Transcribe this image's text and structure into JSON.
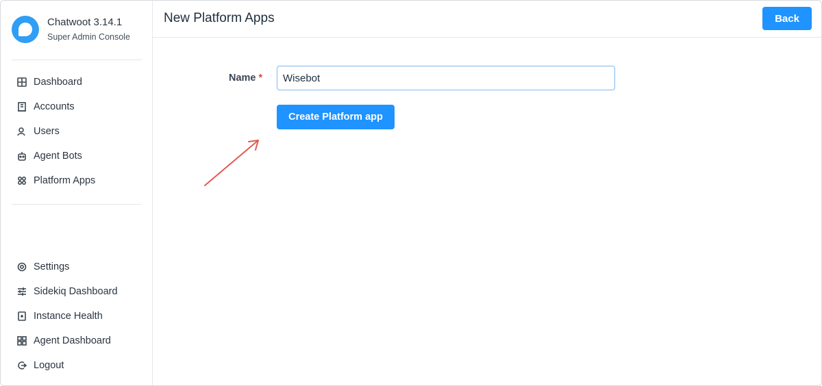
{
  "brand": {
    "title": "Chatwoot 3.14.1",
    "subtitle": "Super Admin Console",
    "logo_icon": "chatwoot-logo",
    "accent_color": "#2f9ef4"
  },
  "nav_primary": [
    {
      "label": "Dashboard",
      "icon": "grid-icon"
    },
    {
      "label": "Accounts",
      "icon": "building-icon"
    },
    {
      "label": "Users",
      "icon": "user-icon"
    },
    {
      "label": "Agent Bots",
      "icon": "bot-icon"
    },
    {
      "label": "Platform Apps",
      "icon": "apps-icon"
    }
  ],
  "nav_secondary": [
    {
      "label": "Settings",
      "icon": "gear-icon"
    },
    {
      "label": "Sidekiq Dashboard",
      "icon": "sliders-icon"
    },
    {
      "label": "Instance Health",
      "icon": "health-icon"
    },
    {
      "label": "Agent Dashboard",
      "icon": "dashboard-icon"
    },
    {
      "label": "Logout",
      "icon": "logout-icon"
    }
  ],
  "header": {
    "title": "New Platform Apps",
    "back_label": "Back"
  },
  "form": {
    "name_label": "Name",
    "required_marker": "*",
    "name_value": "Wisebot",
    "submit_label": "Create Platform app"
  },
  "colors": {
    "primary_button": "#1f93ff",
    "annotation_arrow": "#e05a52",
    "required": "#e0473c"
  }
}
